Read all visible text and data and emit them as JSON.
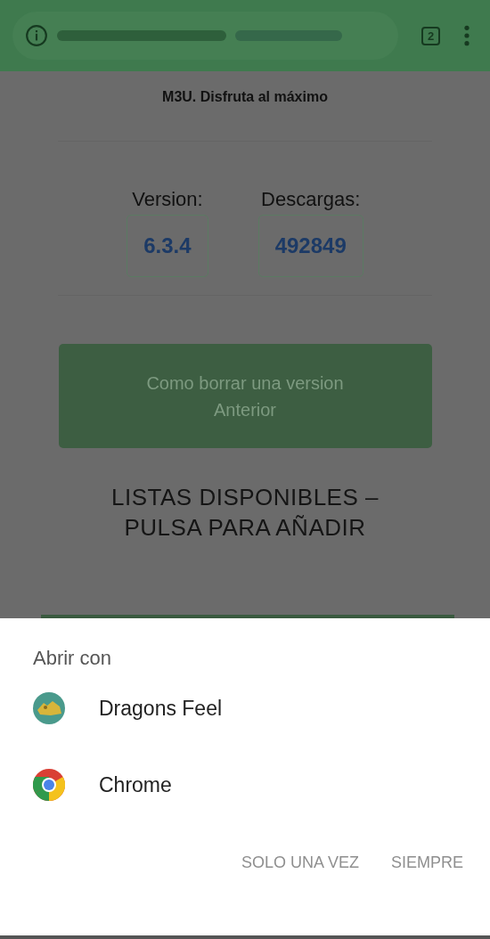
{
  "toolbar": {
    "tab_count": "2"
  },
  "page": {
    "tagline": "M3U. Disfruta al máximo",
    "stats": [
      {
        "label": "Version:",
        "value": "6.3.4"
      },
      {
        "label": "Descargas:",
        "value": "492849"
      }
    ],
    "button": {
      "label": "Como borrar una version Anterior"
    },
    "heading": "LISTAS DISPONIBLES – PULSA PARA AÑADIR"
  },
  "sheet": {
    "title": "Abrir con",
    "apps": [
      {
        "name": "Dragons Feel",
        "kind": "dragon"
      },
      {
        "name": "Chrome",
        "kind": "chrome"
      }
    ],
    "actions": [
      {
        "label": "SOLO UNA VEZ",
        "disabled": true
      },
      {
        "label": "SIEMPRE",
        "disabled": true
      }
    ]
  }
}
